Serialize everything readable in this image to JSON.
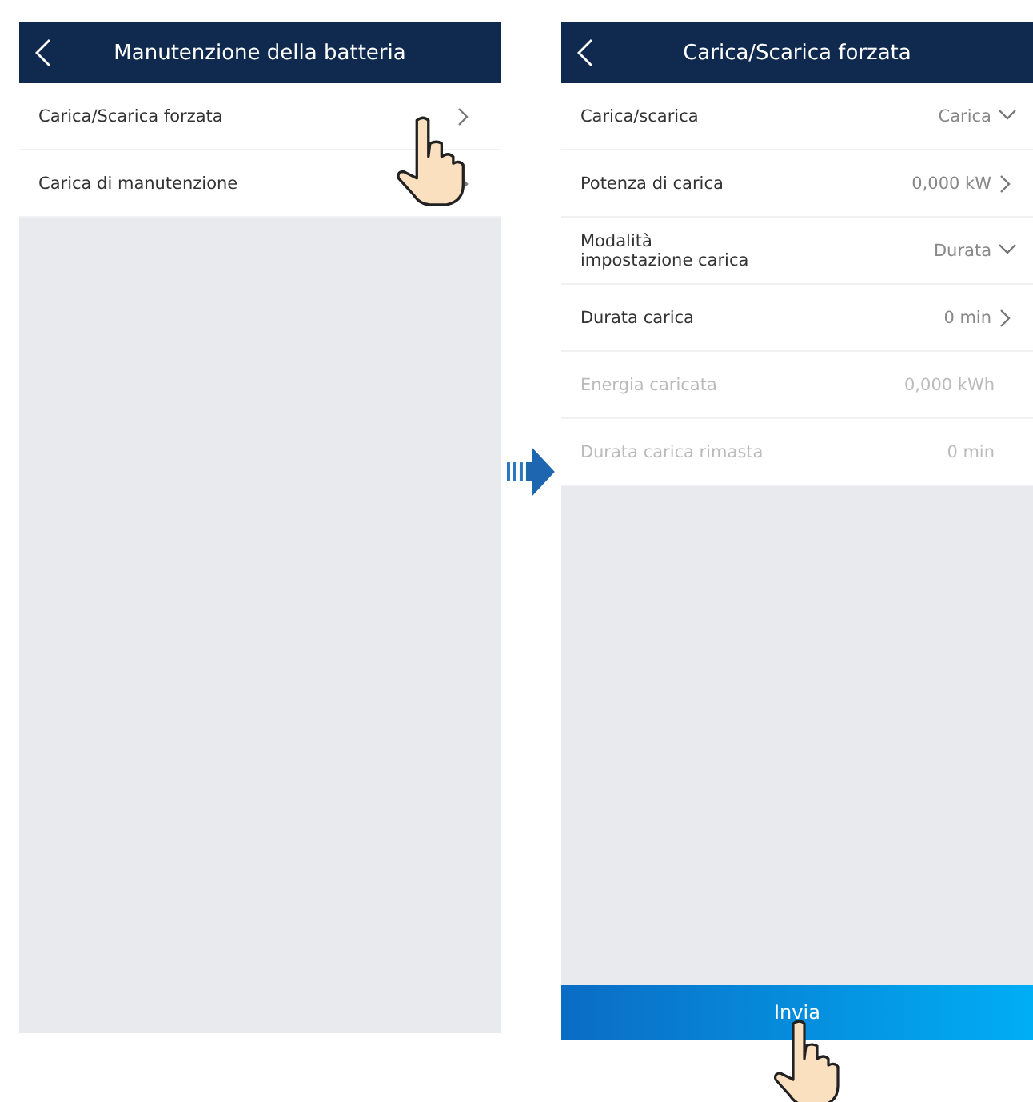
{
  "left_screen": {
    "title": "Manutenzione della batteria",
    "items": [
      {
        "label": "Carica/Scarica forzata"
      },
      {
        "label": "Carica di manutenzione"
      }
    ]
  },
  "right_screen": {
    "title": "Carica/Scarica forzata",
    "rows": [
      {
        "label": "Carica/scarica",
        "value": "Carica",
        "kind": "dropdown",
        "disabled": false
      },
      {
        "label": "Potenza di carica",
        "value": "0,000 kW",
        "kind": "link",
        "disabled": false
      },
      {
        "label": "Modalità impostazione carica",
        "value": "Durata",
        "kind": "dropdown",
        "disabled": false
      },
      {
        "label": "Durata carica",
        "value": "0 min",
        "kind": "link",
        "disabled": false
      },
      {
        "label": "Energia caricata",
        "value": "0,000 kWh",
        "kind": "info",
        "disabled": true
      },
      {
        "label": "Durata carica rimasta",
        "value": "0 min",
        "kind": "info",
        "disabled": true
      }
    ],
    "submit": "Invia"
  }
}
